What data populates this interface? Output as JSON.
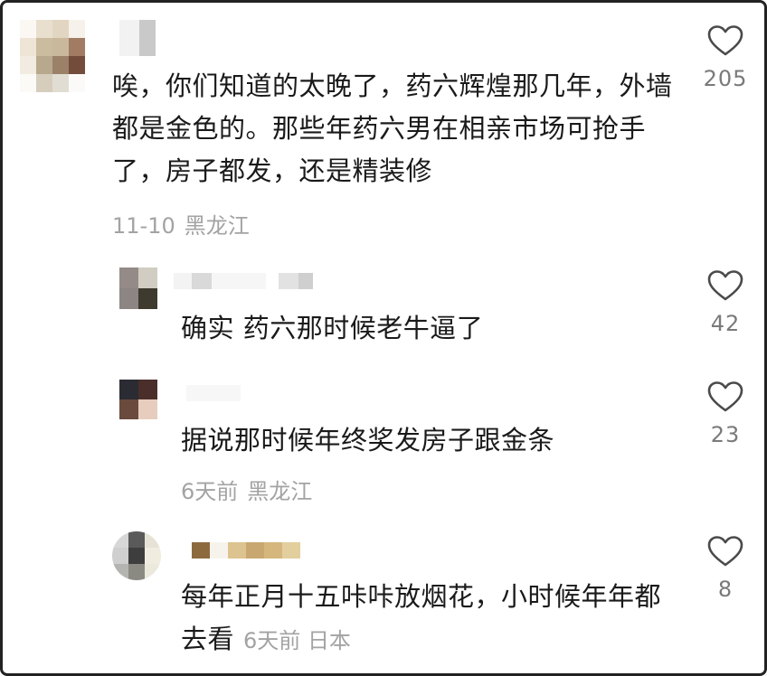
{
  "comments": [
    {
      "text": "唉，你们知道的太晚了，药六辉煌那几年，外墙都是金色的。那些年药六男在相亲市场可抢手了，房子都发，还是精装修",
      "date": "11-10",
      "location": "黑龙江",
      "likes": "205"
    },
    {
      "text": "确实 药六那时候老牛逼了",
      "likes": "42"
    },
    {
      "text": "据说那时候年终奖发房子跟金条",
      "date": "6天前",
      "location": "黑龙江",
      "likes": "23"
    },
    {
      "text": "每年正月十五咔咔放烟花，小时候年年都去看",
      "date": "6天前",
      "location": "日本",
      "likes": "8"
    }
  ]
}
